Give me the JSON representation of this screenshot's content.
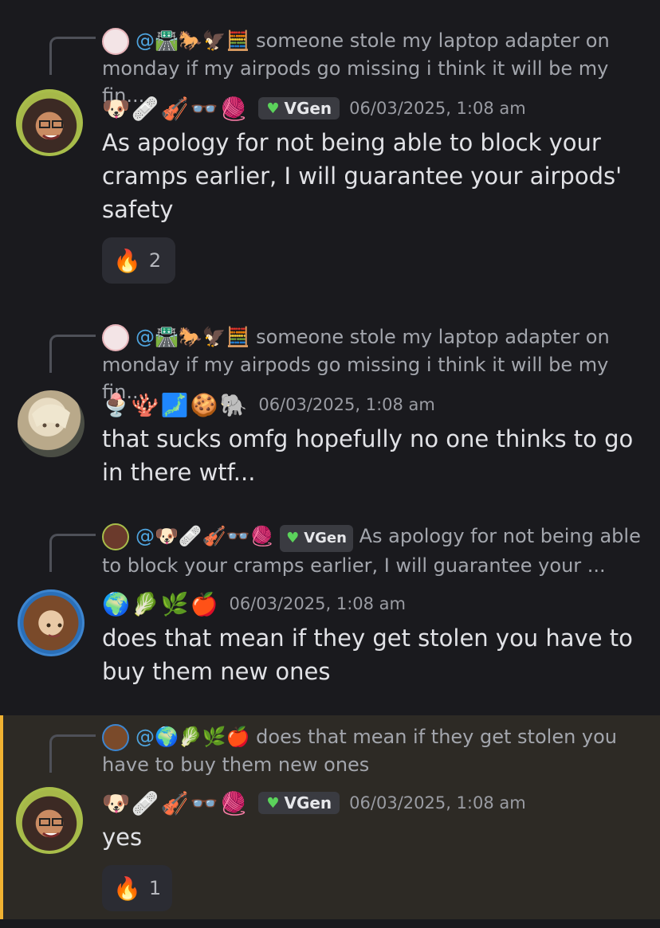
{
  "messages": [
    {
      "reply_to_name": "@🛣️🐎🦅🧮",
      "reply_text": "someone stole my laptop adapter on monday if my airpods go missing i think it will be my fin...",
      "author_name": "🐶🩹🎻👓🧶",
      "tag": "VGen",
      "timestamp": "06/03/2025, 1:08 am",
      "text": "As apology for not being able to block your cramps earlier, I will guarantee your airpods' safety",
      "reaction_emoji": "🔥",
      "reaction_count": "2",
      "avatar_icon": "frog-hat-avatar"
    },
    {
      "reply_to_name": "@🛣️🐎🦅🧮",
      "reply_text": "someone stole my laptop adapter on monday if my airpods go missing i think it will be my fin...",
      "author_name": "🍨🪸🗾🍪🐘",
      "timestamp": "06/03/2025, 1:08 am",
      "text": "that sucks omfg hopefully no one thinks to go in there wtf..."
    },
    {
      "reply_to_name": "@🐶🩹🎻👓🧶",
      "reply_tag": "VGen",
      "reply_text": "As apology for not being able to block your cramps earlier, I will guarantee your ...",
      "author_name": "🌍🥬🌿🍎",
      "timestamp": "06/03/2025, 1:08 am",
      "text": "does that mean if they get stolen you have to buy them new ones"
    },
    {
      "reply_to_name": "@🌍🥬🌿🍎",
      "reply_text": "does that mean if they get stolen you have to buy them new ones",
      "author_name": "🐶🩹🎻👓🧶",
      "tag": "VGen",
      "timestamp": "06/03/2025, 1:08 am",
      "text": "yes",
      "reaction_emoji": "🔥",
      "reaction_count": "1"
    }
  ],
  "colors": {
    "background": "#1a1a1e",
    "highlight_bg": "#2d2a25",
    "highlight_bar": "#f0b232",
    "mention": "#4fa5e0",
    "vgen_heart": "#5bd35b"
  }
}
